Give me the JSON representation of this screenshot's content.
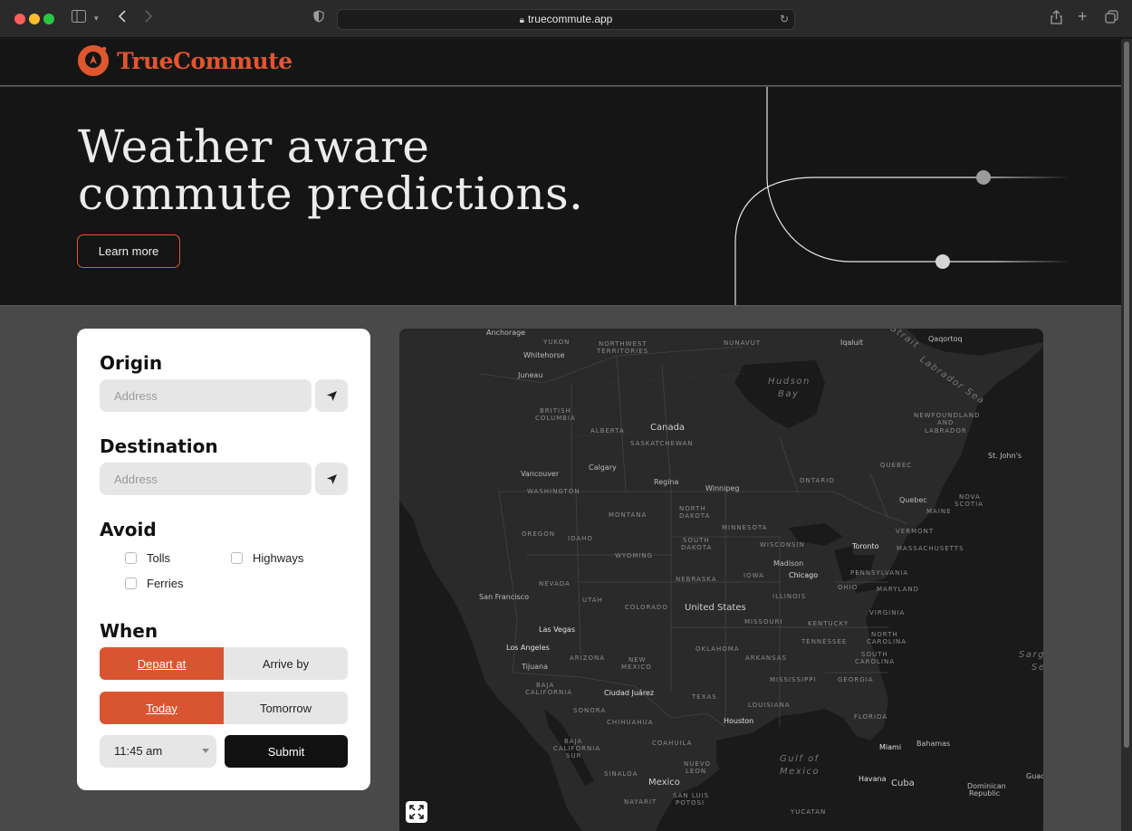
{
  "browser": {
    "url": "truecommute.app"
  },
  "site": {
    "brand": "TrueCommute",
    "colors": {
      "accent": "#e0562f",
      "dark": "#151515",
      "page": "#494949"
    }
  },
  "hero": {
    "title_line1": "Weather aware",
    "title_line2": "commute predictions.",
    "cta": "Learn more"
  },
  "form": {
    "origin": {
      "title": "Origin",
      "placeholder": "Address",
      "icon": "location-arrow-icon"
    },
    "destination": {
      "title": "Destination",
      "placeholder": "Address",
      "icon": "location-arrow-icon"
    },
    "avoid": {
      "title": "Avoid",
      "options": [
        {
          "label": "Tolls",
          "checked": false
        },
        {
          "label": "Highways",
          "checked": false
        },
        {
          "label": "Ferries",
          "checked": false
        }
      ]
    },
    "when": {
      "title": "When",
      "mode": {
        "selected": "Depart at",
        "options": [
          "Depart at",
          "Arrive by"
        ]
      },
      "day": {
        "selected": "Today",
        "options": [
          "Today",
          "Tomorrow"
        ]
      },
      "time": "11:45 am",
      "submit": "Submit"
    }
  },
  "map": {
    "labels": {
      "anchorage": "Anchorage",
      "yukon": "YUKON",
      "nwt1": "NORTHWEST",
      "nwt2": "TERRITORIES",
      "nunavut": "NUNAVUT",
      "iqaluit": "Iqaluit",
      "qaqortoq": "Qaqortoq",
      "whitehorse": "Whitehorse",
      "juneau": "Juneau",
      "hudson1": "Hudson",
      "hudson2": "Bay",
      "strait": "Strait",
      "labrador1": "Labrador Sea",
      "bc1": "BRITISH",
      "bc2": "COLUMBIA",
      "canada": "Canada",
      "alberta": "ALBERTA",
      "sask": "SASKATCHEWAN",
      "nl1": "NEWFOUNDLAND",
      "nl2": "AND",
      "nl3": "LABRADOR",
      "stjohns": "St. John's",
      "calgary": "Calgary",
      "vancouver": "Vancouver",
      "regina": "Regina",
      "quebec_prov": "QUÉBEC",
      "ontario": "ONTARIO",
      "winnipeg": "Winnipeg",
      "quebec_city": "Quebec",
      "washington": "WASHINGTON",
      "maine": "MAINE",
      "ns1": "NOVA",
      "ns2": "SCOTIA",
      "montana": "MONTANA",
      "nd1": "NORTH",
      "nd2": "DAKOTA",
      "minnesota": "MINNESOTA",
      "oregon": "OREGON",
      "idaho": "IDAHO",
      "wyoming": "WYOMING",
      "sd1": "SOUTH",
      "sd2": "DAKOTA",
      "wisconsin": "WISCONSIN",
      "toronto": "Toronto",
      "vermont": "VERMONT",
      "mass": "MASSACHUSETTS",
      "madison": "Madison",
      "chicago": "Chicago",
      "nebraska": "NEBRASKA",
      "iowa": "IOWA",
      "pennsylvania": "PENNSYLVANIA",
      "nevada": "NEVADA",
      "sanfrancisco": "San Francisco",
      "utah": "UTAH",
      "colorado": "COLORADO",
      "illinois": "ILLINOIS",
      "ohio": "OHIO",
      "maryland": "MARYLAND",
      "unitedstates": "United States",
      "missouri": "MISSOURI",
      "kentucky": "KENTUCKY",
      "virginia": "VIRGINIA",
      "lasvegas": "Las Vegas",
      "nc1": "NORTH",
      "nc2": "CAROLINA",
      "losangeles": "Los Angeles",
      "arizona": "ARIZONA",
      "oklahoma": "OKLAHOMA",
      "tennessee": "TENNESSEE",
      "arkansas": "ARKANSAS",
      "sc1": "SOUTH",
      "sc2": "CAROLINA",
      "nm1": "NEW",
      "nm2": "MEXICO",
      "tijuana": "Tijuana",
      "sargasso1": "Sarg",
      "sargasso2": "Se",
      "bc_mx1": "BAJA",
      "bc_mx2": "CALIFORNIA",
      "mississippi": "MISSISSIPPI",
      "georgia": "GEORGIA",
      "ciudadjuarez": "Ciudad Juárez",
      "texas": "TEXAS",
      "louisiana": "LOUISIANA",
      "sonora": "SONORA",
      "chihuahua": "CHIHUAHUA",
      "houston": "Houston",
      "florida": "FLORIDA",
      "bcs1": "BAJA",
      "bcs2": "CALIFORNIA",
      "bcs3": "SUR",
      "coahuila": "COAHUILA",
      "miami": "Miami",
      "bahamas": "Bahamas",
      "gulf1": "Gulf of",
      "gulf2": "Mexico",
      "nl_mx1": "NUEVO",
      "nl_mx2": "LEON",
      "sinaloa": "SINALOA",
      "mexico": "Mexico",
      "havana": "Havana",
      "cuba": "Cuba",
      "dr1": "Dominican",
      "dr2": "Republic",
      "nayarit": "NAYARIT",
      "slp1": "SAN LUIS",
      "slp2": "POTOSI",
      "guad": "Guad",
      "yucatan": "YUCATAN"
    }
  }
}
